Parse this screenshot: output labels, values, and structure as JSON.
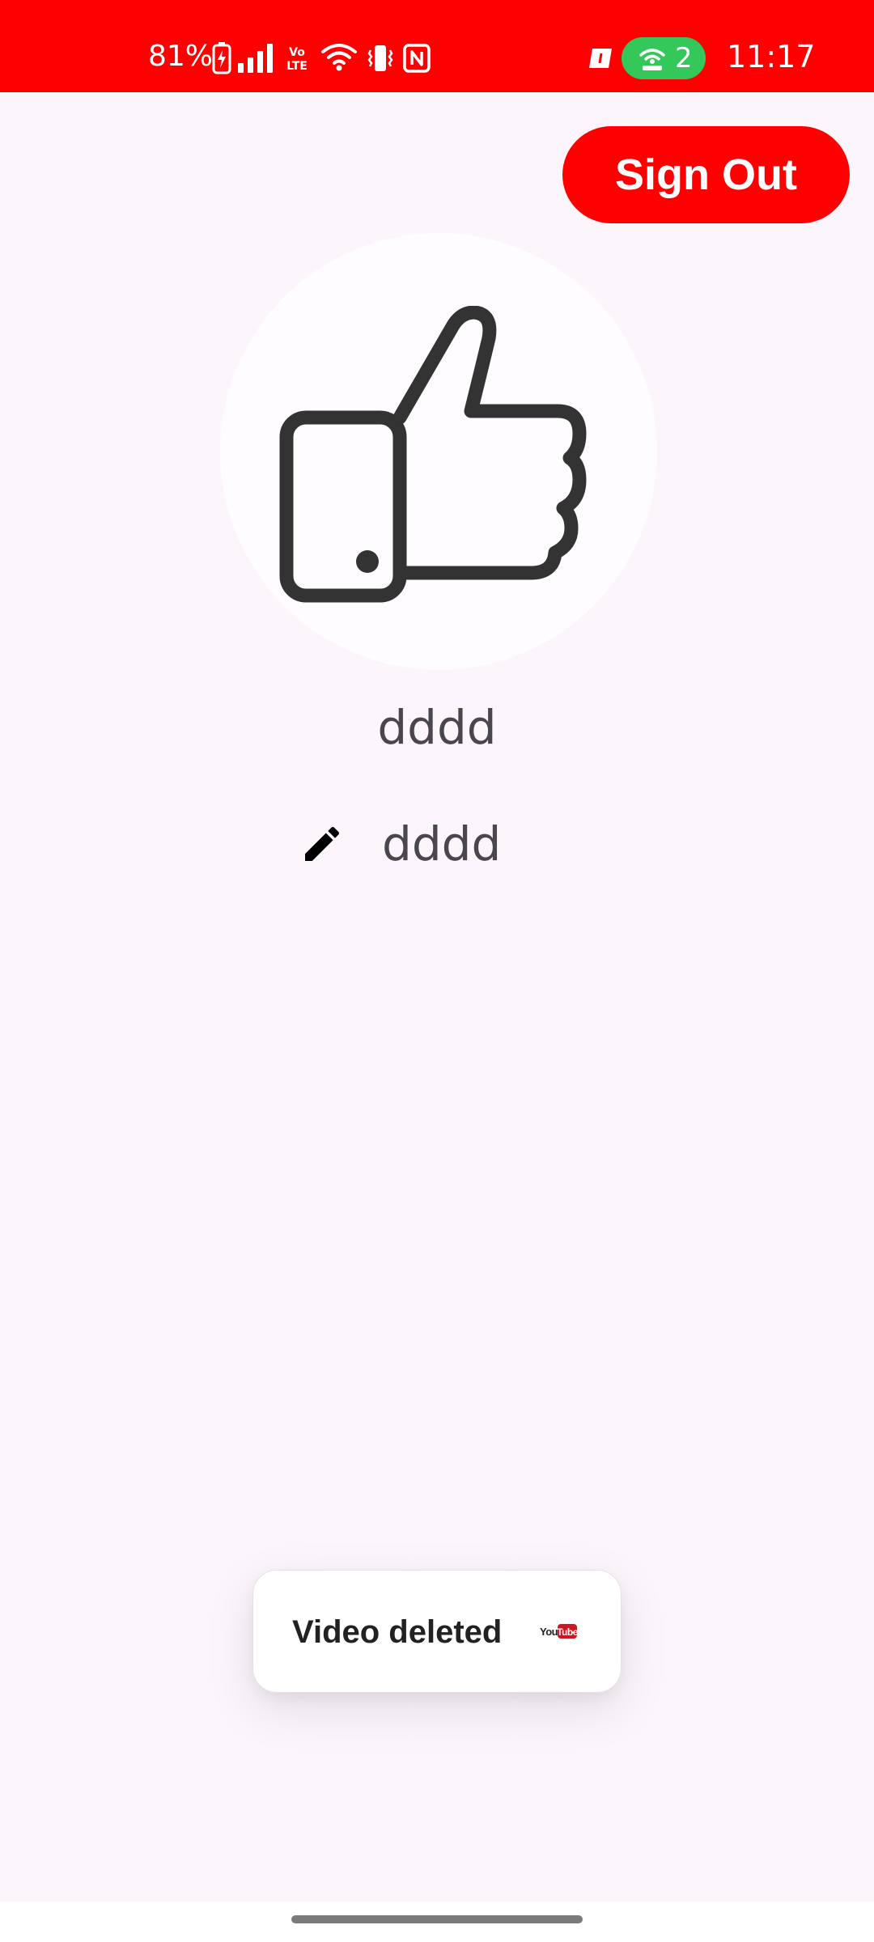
{
  "status_bar": {
    "battery": "81%",
    "volte": "Vo LTE",
    "hotspot_count": "2",
    "time": "11:17",
    "background_color": "#ff0000",
    "icons": [
      "battery-charging-icon",
      "signal-icon",
      "volte-icon",
      "wifi-icon",
      "vibrate-icon",
      "nfc-icon",
      "notification-icon",
      "hotspot-icon"
    ]
  },
  "header": {
    "sign_out_label": "Sign Out",
    "sign_out_color": "#ff0000"
  },
  "profile": {
    "avatar_icon": "thumbs-up-icon",
    "username": "dddd",
    "editable_name": "dddd",
    "edit_icon": "pencil-icon"
  },
  "toast": {
    "message": "Video deleted",
    "icon": "youtube-logo-icon",
    "icon_text": "YouTube"
  },
  "theme": {
    "background": "#fcf5fc",
    "text": "#4a4650"
  }
}
